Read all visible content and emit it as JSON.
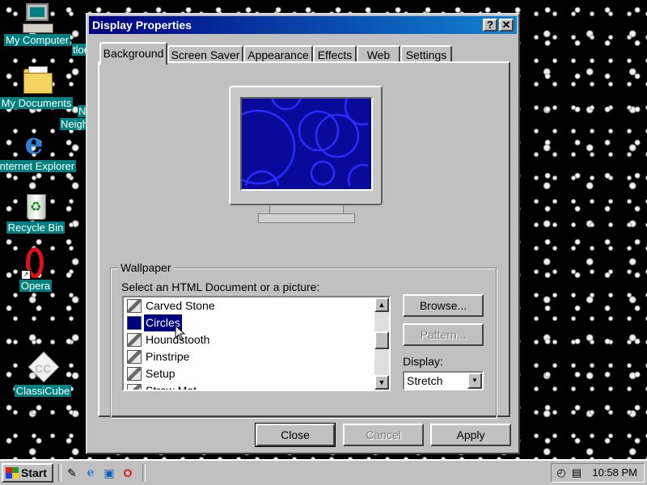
{
  "desktop": {
    "icons": [
      {
        "label": "My Computer"
      },
      {
        "label": "My Documents"
      },
      {
        "label": "Internet Explorer"
      },
      {
        "label": "Recycle Bin"
      },
      {
        "label": "Opera"
      },
      {
        "label": "ClassiCube"
      }
    ],
    "partial_labels": [
      "tloo",
      "Ne",
      "Neigh"
    ]
  },
  "dialog": {
    "title": "Display Properties",
    "help_btn": "?",
    "close_btn": "✕",
    "tabs": [
      "Background",
      "Screen Saver",
      "Appearance",
      "Effects",
      "Web",
      "Settings"
    ],
    "active_tab": "Background",
    "wallpaper_group": "Wallpaper",
    "prompt": "Select an HTML Document or a picture:",
    "wallpapers": [
      "Carved Stone",
      "Circles",
      "Houndstooth",
      "Pinstripe",
      "Setup",
      "Straw Mat"
    ],
    "selected_wallpaper": "Circles",
    "browse_btn": "Browse...",
    "pattern_btn": "Pattern...",
    "display_label": "Display:",
    "display_value": "Stretch",
    "close_label": "Close",
    "cancel_label": "Cancel",
    "apply_label": "Apply"
  },
  "taskbar": {
    "start_label": "Start",
    "clock": "10:58 PM"
  },
  "colors": {
    "title_bar": "#000080",
    "desktop_label_bg": "#008080",
    "selection": "#000080",
    "preview_bg": "#0a0a9a"
  }
}
